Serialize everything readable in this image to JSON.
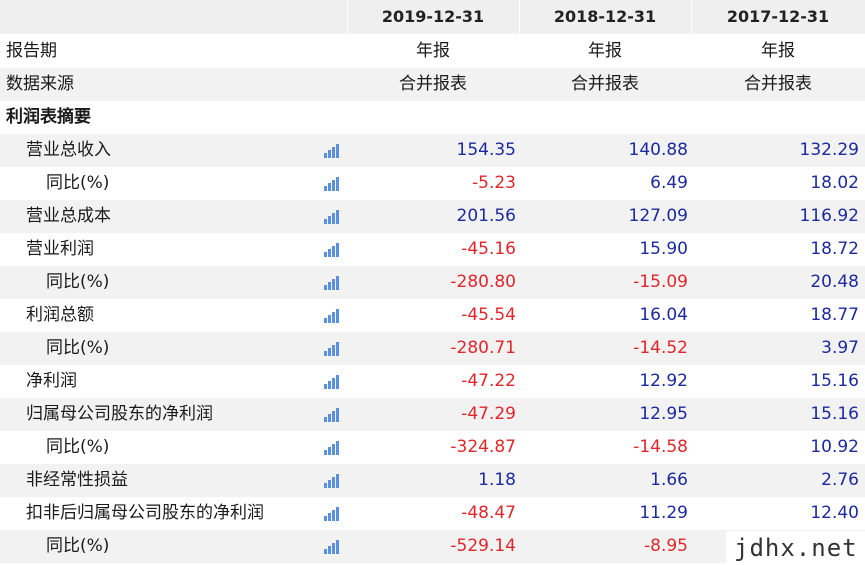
{
  "header": {
    "dates": [
      "2019-12-31",
      "2018-12-31",
      "2017-12-31"
    ]
  },
  "rows": [
    {
      "label": "报告期",
      "type": "text",
      "values": [
        "年报",
        "年报",
        "年报"
      ]
    },
    {
      "label": "数据来源",
      "type": "text",
      "values": [
        "合并报表",
        "合并报表",
        "合并报表"
      ]
    },
    {
      "label": "利润表摘要",
      "type": "section"
    },
    {
      "label": "营业总收入",
      "type": "data",
      "values": [
        "154.35",
        "140.88",
        "132.29"
      ]
    },
    {
      "label": "同比(%)",
      "type": "data",
      "sub": true,
      "values": [
        "-5.23",
        "6.49",
        "18.02"
      ]
    },
    {
      "label": "营业总成本",
      "type": "data",
      "values": [
        "201.56",
        "127.09",
        "116.92"
      ]
    },
    {
      "label": "营业利润",
      "type": "data",
      "values": [
        "-45.16",
        "15.90",
        "18.72"
      ]
    },
    {
      "label": "同比(%)",
      "type": "data",
      "sub": true,
      "values": [
        "-280.80",
        "-15.09",
        "20.48"
      ]
    },
    {
      "label": "利润总额",
      "type": "data",
      "values": [
        "-45.54",
        "16.04",
        "18.77"
      ]
    },
    {
      "label": "同比(%)",
      "type": "data",
      "sub": true,
      "values": [
        "-280.71",
        "-14.52",
        "3.97"
      ]
    },
    {
      "label": "净利润",
      "type": "data",
      "values": [
        "-47.22",
        "12.92",
        "15.16"
      ]
    },
    {
      "label": "归属母公司股东的净利润",
      "type": "data",
      "values": [
        "-47.29",
        "12.95",
        "15.16"
      ]
    },
    {
      "label": "同比(%)",
      "type": "data",
      "sub": true,
      "values": [
        "-324.87",
        "-14.58",
        "10.92"
      ]
    },
    {
      "label": "非经常性损益",
      "type": "data",
      "values": [
        "1.18",
        "1.66",
        "2.76"
      ]
    },
    {
      "label": "扣非后归属母公司股东的净利润",
      "type": "data",
      "values": [
        "-48.47",
        "11.29",
        "12.40"
      ]
    },
    {
      "label": "同比(%)",
      "type": "data",
      "sub": true,
      "values": [
        "-529.14",
        "-8.95",
        ""
      ]
    }
  ],
  "watermark": "jdhx.net",
  "icon": "bar-chart-icon",
  "colors": {
    "positive": "#1b2a9e",
    "negative": "#e0262b",
    "header_bg": "#efefef",
    "stripe": "#f2f2f2",
    "icon": "#5b8fe0"
  }
}
